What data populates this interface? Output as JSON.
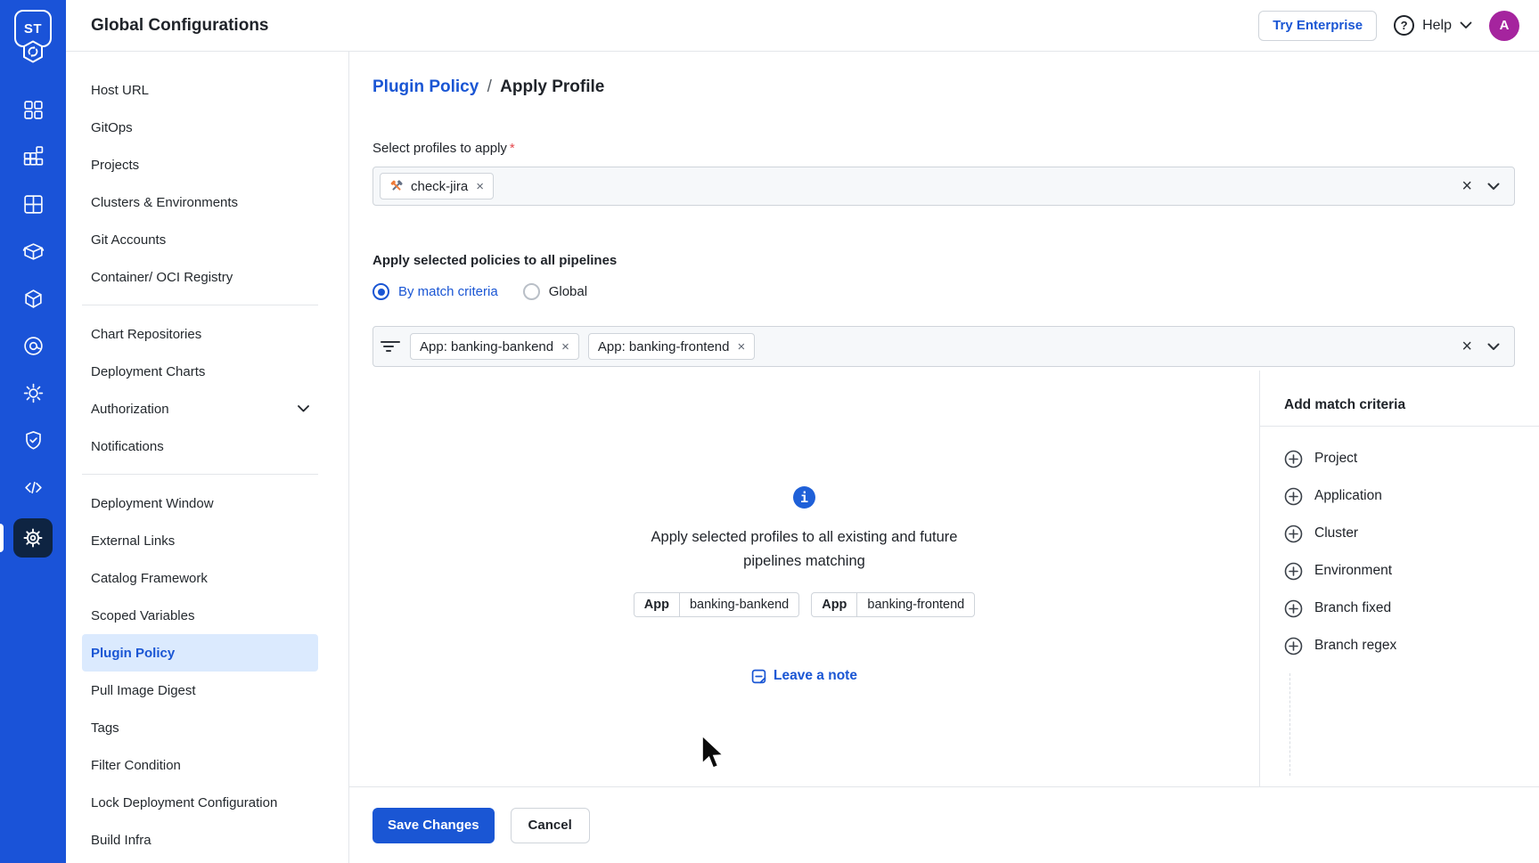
{
  "colors": {
    "rail_blue": "#1a53d8",
    "accent_blue": "#1a56d4",
    "active_tile": "#0e2442",
    "avatar_purple": "#a5249e",
    "selected_bg": "#dbeafe",
    "border": "#cfd4da",
    "divider": "#e3e6ea",
    "text_dark": "#1f2329",
    "select_bg": "#f6f8fa",
    "required_red": "#e5484d",
    "info_blue": "#1f60d8"
  },
  "glyphs": {
    "remove": "×",
    "clear": "×",
    "help": "?"
  },
  "header": {
    "logo_text": "ST",
    "title": "Global Configurations",
    "try_enterprise_label": "Try Enterprise",
    "help_label": "Help",
    "avatar_initial": "A"
  },
  "rail": {
    "icons": [
      "apps-grid-icon",
      "jobs-icon",
      "application-groups-icon",
      "chart-store-icon",
      "releases-cube-icon",
      "resource-browser-icon",
      "cluster-icon",
      "security-shield-icon",
      "code-icon",
      "global-config-gear-icon"
    ]
  },
  "sidebar": {
    "groups": [
      {
        "items": [
          {
            "label": "Host URL"
          },
          {
            "label": "GitOps"
          },
          {
            "label": "Projects"
          },
          {
            "label": "Clusters & Environments"
          },
          {
            "label": "Git Accounts"
          },
          {
            "label": "Container/ OCI Registry"
          }
        ]
      },
      {
        "items": [
          {
            "label": "Chart Repositories"
          },
          {
            "label": "Deployment Charts"
          },
          {
            "label": "Authorization",
            "chevron": true
          },
          {
            "label": "Notifications"
          }
        ]
      },
      {
        "items": [
          {
            "label": "Deployment Window"
          },
          {
            "label": "External Links"
          },
          {
            "label": "Catalog Framework"
          },
          {
            "label": "Scoped Variables"
          },
          {
            "label": "Plugin Policy",
            "selected": true
          },
          {
            "label": "Pull Image Digest"
          },
          {
            "label": "Tags"
          },
          {
            "label": "Filter Condition"
          },
          {
            "label": "Lock Deployment Configuration"
          },
          {
            "label": "Build Infra"
          }
        ]
      }
    ]
  },
  "main": {
    "breadcrumb": {
      "parent": "Plugin Policy",
      "separator": "/",
      "current": "Apply Profile"
    },
    "profiles": {
      "label": "Select profiles to apply",
      "required": "*",
      "chip_label": "check-jira"
    },
    "scope": {
      "heading": "Apply selected policies to all pipelines",
      "options": [
        {
          "label": "By match criteria",
          "selected": true
        },
        {
          "label": "Global",
          "selected": false
        }
      ]
    },
    "match_filter": {
      "chips": [
        {
          "label": "App: banking-bankend"
        },
        {
          "label": "App: banking-frontend"
        }
      ]
    },
    "summary": {
      "line1": "Apply selected profiles to all existing and future",
      "line2": "pipelines matching",
      "chips": [
        {
          "key": "App",
          "value": "banking-bankend"
        },
        {
          "key": "App",
          "value": "banking-frontend"
        }
      ],
      "note_label": "Leave a note"
    },
    "criteria": {
      "title": "Add match criteria",
      "items": [
        "Project",
        "Application",
        "Cluster",
        "Environment",
        "Branch fixed",
        "Branch regex"
      ]
    },
    "footer": {
      "save_label": "Save Changes",
      "cancel_label": "Cancel"
    }
  }
}
